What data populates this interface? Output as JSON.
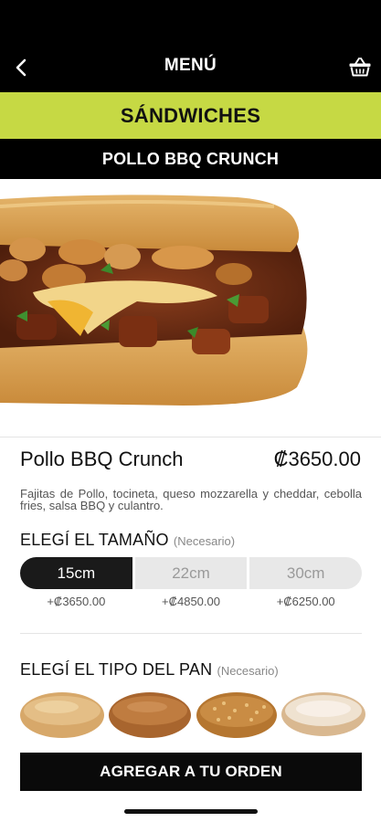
{
  "header": {
    "title": "MENÚ",
    "back_icon": "chevron-left-icon",
    "cart_icon": "basket-icon"
  },
  "category": {
    "label": "SÁNDWICHES"
  },
  "product_bar": {
    "label": "POLLO BBQ CRUNCH"
  },
  "product": {
    "name": "Pollo BBQ Crunch",
    "price": "₡3650.00",
    "description": "Fajitas de Pollo, tocineta, queso mozzarella y cheddar, cebolla fries, salsa BBQ y culantro."
  },
  "size_section": {
    "title": "ELEGÍ EL TAMAÑO",
    "required": "(Necesario)",
    "options": [
      {
        "label": "15cm",
        "price": "+₡3650.00",
        "selected": true
      },
      {
        "label": "22cm",
        "price": "+₡4850.00",
        "selected": false
      },
      {
        "label": "30cm",
        "price": "+₡6250.00",
        "selected": false
      }
    ]
  },
  "bread_section": {
    "title": "ELEGÍ EL TIPO DEL PAN",
    "required": "(Necesario)"
  },
  "cta": {
    "label": "AGREGAR A TU ORDEN"
  },
  "colors": {
    "accent": "#c6d944",
    "dark": "#000000",
    "selected": "#1a1a1a",
    "unselected": "#e8e8e8"
  }
}
